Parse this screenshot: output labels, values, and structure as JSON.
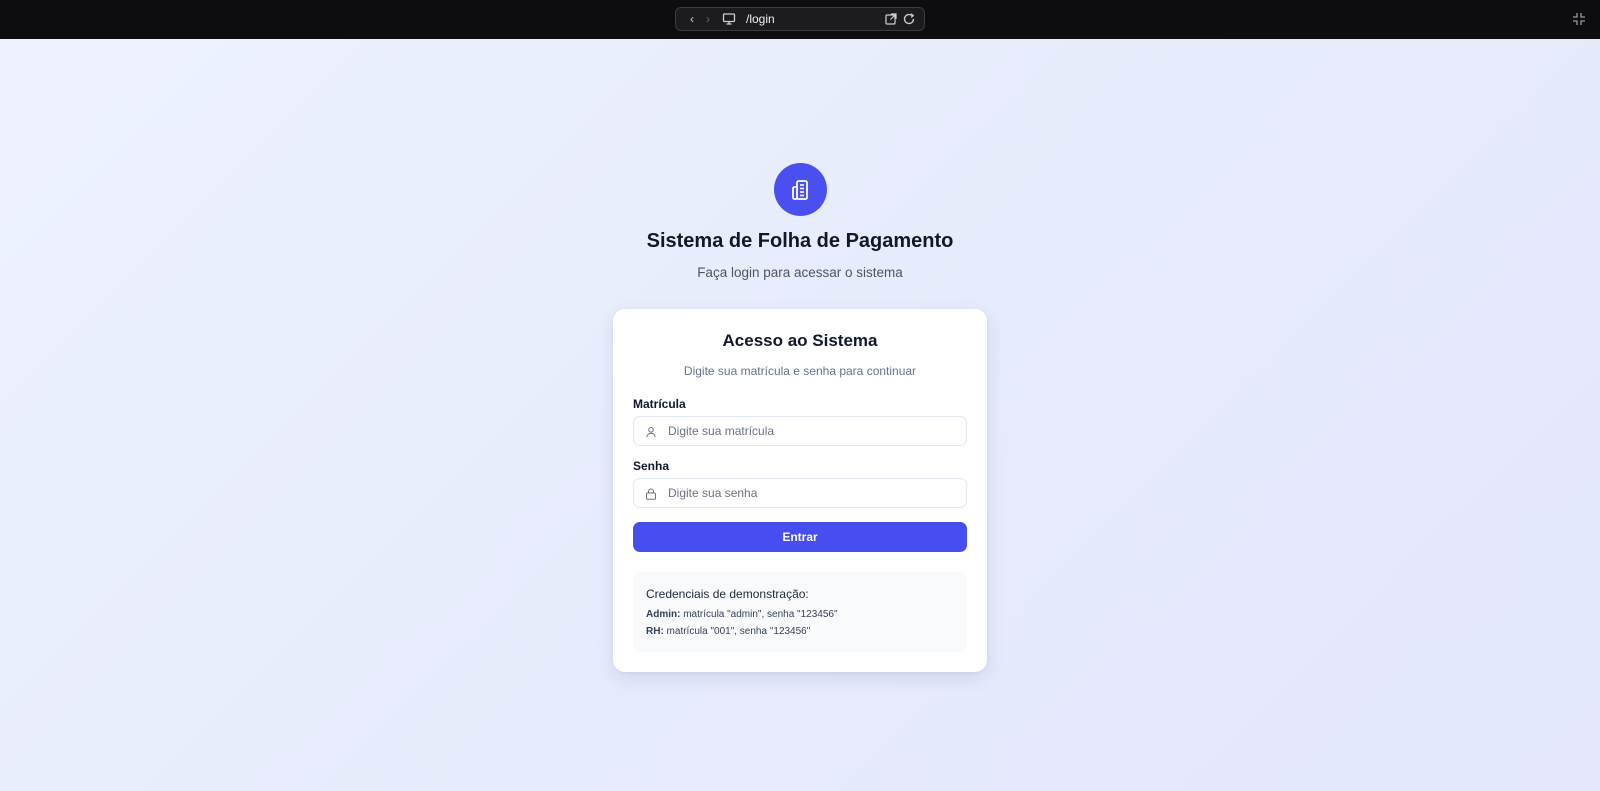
{
  "browser": {
    "url": "/login"
  },
  "header": {
    "title": "Sistema de Folha de Pagamento",
    "subtitle": "Faça login para acessar o sistema"
  },
  "card": {
    "title": "Acesso ao Sistema",
    "description": "Digite sua matrícula e senha para continuar",
    "matricula": {
      "label": "Matrícula",
      "placeholder": "Digite sua matrícula",
      "value": ""
    },
    "senha": {
      "label": "Senha",
      "placeholder": "Digite sua senha",
      "value": ""
    },
    "submit_label": "Entrar",
    "demo": {
      "title": "Credenciais de demonstração:",
      "admin_label": "Admin:",
      "admin_text": " matrícula \"admin\", senha \"123456\"",
      "rh_label": "RH:",
      "rh_text": " matrícula \"001\", senha \"123456\""
    }
  },
  "colors": {
    "accent": "#474ef0",
    "topbar": "#0d0d0f"
  },
  "icons": {
    "logo": "building-icon",
    "matricula": "user-icon",
    "senha": "lock-icon"
  }
}
